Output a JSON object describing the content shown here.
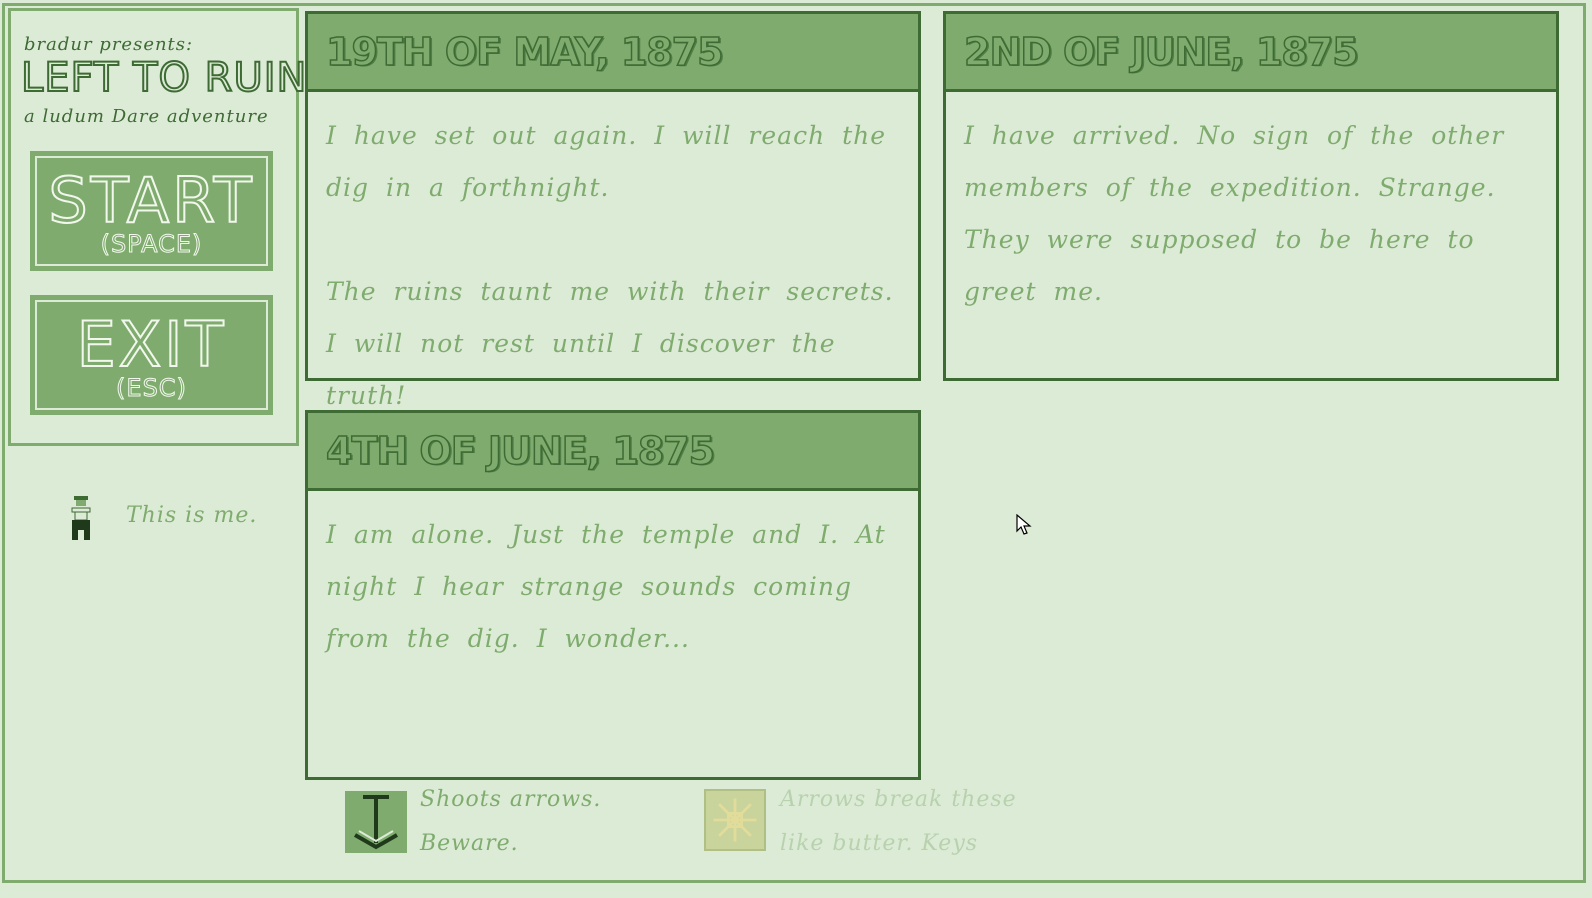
{
  "menu": {
    "presents": "bradur presents:",
    "title": "LEFT TO RUIN",
    "subtitle": "a ludum Dare adventure",
    "start": {
      "label": "START",
      "key": "(SPACE)"
    },
    "exit": {
      "label": "EXIT",
      "key": "(ESC)"
    }
  },
  "legend": {
    "player": {
      "icon": "player-icon",
      "text": "This is me."
    },
    "turret": {
      "icon": "arrow-turret-icon",
      "line1": "Shoots arrows.",
      "line2": "Beware."
    },
    "block": {
      "icon": "breakable-block-icon",
      "line1": "Arrows break these",
      "line2": "like butter. Keys"
    }
  },
  "entries": [
    {
      "date": "19TH OF MAY, 1875",
      "paragraphs": [
        "I have set out again. I will reach the dig in a forthnight.",
        "The ruins taunt me with their secrets. I will not rest until I discover the truth!"
      ]
    },
    {
      "date": "2ND OF JUNE, 1875",
      "paragraphs": [
        "I have arrived. No sign of the other members of the expedition. Strange. They were supposed to be here to greet me."
      ]
    },
    {
      "date": "4TH OF JUNE, 1875",
      "paragraphs": [
        "I am alone. Just the temple and I. At night I hear strange sounds coming from the dig. I wonder..."
      ]
    }
  ],
  "colors": {
    "background": "#dcebd6",
    "accent": "#7fac6e",
    "dark": "#3e6a34"
  }
}
